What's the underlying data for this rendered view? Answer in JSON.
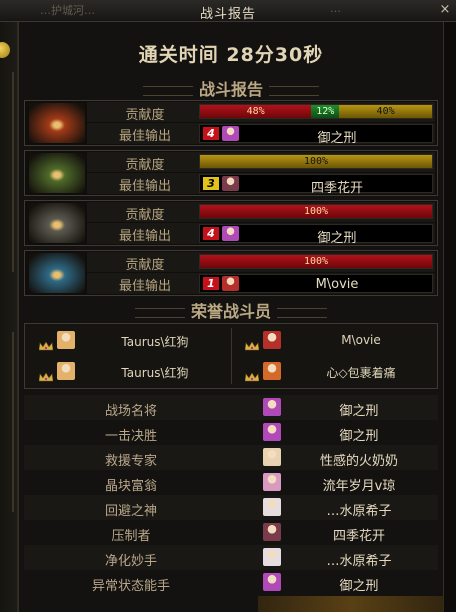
{
  "window": {
    "title": "战斗报告",
    "close_label": "×",
    "background_fragment_left": "…护城河…",
    "background_fragment_right": "…"
  },
  "clear_time": "通关时间   28分30秒",
  "battle_report": {
    "title": "战斗报告",
    "contribution_label": "贡献度",
    "best_output_label": "最佳输出",
    "entries": [
      {
        "portrait_icon": "red-fire-helmet-icon",
        "portrait_color": "#a23a18",
        "segments": [
          {
            "percent_label": "48%",
            "value": 48,
            "color": "red"
          },
          {
            "percent_label": "12%",
            "value": 12,
            "color": "green"
          },
          {
            "percent_label": "40%",
            "value": 40,
            "color": "gold"
          }
        ],
        "rank": "4",
        "rank_color": "red",
        "player_icon": "purple-hair-avatar-icon",
        "player_icon_color": "#b04ab8",
        "best_player": "御之刑"
      },
      {
        "portrait_icon": "green-thorn-helmet-icon",
        "portrait_color": "#4f6a2a",
        "segments": [
          {
            "percent_label": "100%",
            "value": 100,
            "color": "gold"
          }
        ],
        "rank": "3",
        "rank_color": "yellow",
        "player_icon": "dark-hair-avatar-icon",
        "player_icon_color": "#7a3b4a",
        "best_player": "四季花开"
      },
      {
        "portrait_icon": "gray-horned-helmet-icon",
        "portrait_color": "#5c5a50",
        "segments": [
          {
            "percent_label": "100%",
            "value": 100,
            "color": "red"
          }
        ],
        "rank": "4",
        "rank_color": "red",
        "player_icon": "purple-hair-avatar-icon",
        "player_icon_color": "#b04ab8",
        "best_player": "御之刑"
      },
      {
        "portrait_icon": "blue-ice-helmet-icon",
        "portrait_color": "#2f6a86",
        "segments": [
          {
            "percent_label": "100%",
            "value": 100,
            "color": "red"
          }
        ],
        "rank": "1",
        "rank_color": "red",
        "player_icon": "red-armor-avatar-icon",
        "player_icon_color": "#b5302a",
        "best_player": "M\\ovie"
      }
    ]
  },
  "honor": {
    "title": "荣誉战斗员",
    "members": [
      {
        "name": "Taurus\\红狗",
        "icon": "blonde-avatar-icon",
        "icon_color": "#e2b26a"
      },
      {
        "name": "M\\ovie",
        "icon": "red-armor-avatar-icon",
        "icon_color": "#b5302a"
      },
      {
        "name": "Taurus\\红狗",
        "icon": "blonde-avatar-icon",
        "icon_color": "#e2b26a"
      },
      {
        "name": "心◇包裹着痛",
        "icon": "orange-hair-avatar-icon",
        "icon_color": "#d46a2a"
      }
    ]
  },
  "awards": [
    {
      "title": "战场名将",
      "player": "御之刑",
      "icon": "purple-hair-avatar-icon",
      "icon_color": "#b04ab8"
    },
    {
      "title": "一击决胜",
      "player": "御之刑",
      "icon": "purple-hair-avatar-icon",
      "icon_color": "#b04ab8"
    },
    {
      "title": "救援专家",
      "player": "性感的火奶奶",
      "icon": "light-hair-avatar-icon",
      "icon_color": "#e8d2b0"
    },
    {
      "title": "晶块富翁",
      "player": "流年岁月v琼",
      "icon": "pink-avatar-icon",
      "icon_color": "#d99ac0"
    },
    {
      "title": "回避之神",
      "player": "…水原希子",
      "icon": "white-hair-avatar-icon",
      "icon_color": "#e6dde0"
    },
    {
      "title": "压制者",
      "player": "四季花开",
      "icon": "dark-hair-avatar-icon",
      "icon_color": "#7a3b4a"
    },
    {
      "title": "净化妙手",
      "player": "…水原希子",
      "icon": "white-hair-avatar-icon",
      "icon_color": "#e6dde0"
    },
    {
      "title": "异常状态能手",
      "player": "御之刑",
      "icon": "purple-hair-avatar-icon",
      "icon_color": "#b04ab8"
    }
  ],
  "colors": {
    "bar_red": "#b2121a",
    "bar_green": "#1f8d2c",
    "bar_gold": "#b89612",
    "text_gold": "#bba884"
  }
}
